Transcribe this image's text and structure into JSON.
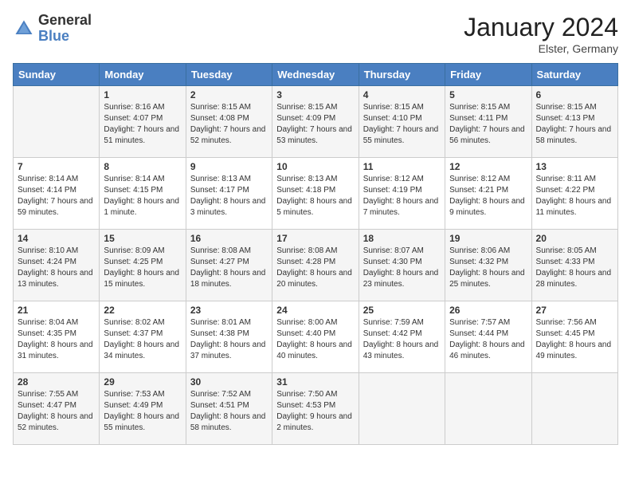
{
  "logo": {
    "general": "General",
    "blue": "Blue"
  },
  "title": "January 2024",
  "location": "Elster, Germany",
  "days_header": [
    "Sunday",
    "Monday",
    "Tuesday",
    "Wednesday",
    "Thursday",
    "Friday",
    "Saturday"
  ],
  "weeks": [
    [
      {
        "day": "",
        "sunrise": "",
        "sunset": "",
        "daylight": ""
      },
      {
        "day": "1",
        "sunrise": "Sunrise: 8:16 AM",
        "sunset": "Sunset: 4:07 PM",
        "daylight": "Daylight: 7 hours and 51 minutes."
      },
      {
        "day": "2",
        "sunrise": "Sunrise: 8:15 AM",
        "sunset": "Sunset: 4:08 PM",
        "daylight": "Daylight: 7 hours and 52 minutes."
      },
      {
        "day": "3",
        "sunrise": "Sunrise: 8:15 AM",
        "sunset": "Sunset: 4:09 PM",
        "daylight": "Daylight: 7 hours and 53 minutes."
      },
      {
        "day": "4",
        "sunrise": "Sunrise: 8:15 AM",
        "sunset": "Sunset: 4:10 PM",
        "daylight": "Daylight: 7 hours and 55 minutes."
      },
      {
        "day": "5",
        "sunrise": "Sunrise: 8:15 AM",
        "sunset": "Sunset: 4:11 PM",
        "daylight": "Daylight: 7 hours and 56 minutes."
      },
      {
        "day": "6",
        "sunrise": "Sunrise: 8:15 AM",
        "sunset": "Sunset: 4:13 PM",
        "daylight": "Daylight: 7 hours and 58 minutes."
      }
    ],
    [
      {
        "day": "7",
        "sunrise": "Sunrise: 8:14 AM",
        "sunset": "Sunset: 4:14 PM",
        "daylight": "Daylight: 7 hours and 59 minutes."
      },
      {
        "day": "8",
        "sunrise": "Sunrise: 8:14 AM",
        "sunset": "Sunset: 4:15 PM",
        "daylight": "Daylight: 8 hours and 1 minute."
      },
      {
        "day": "9",
        "sunrise": "Sunrise: 8:13 AM",
        "sunset": "Sunset: 4:17 PM",
        "daylight": "Daylight: 8 hours and 3 minutes."
      },
      {
        "day": "10",
        "sunrise": "Sunrise: 8:13 AM",
        "sunset": "Sunset: 4:18 PM",
        "daylight": "Daylight: 8 hours and 5 minutes."
      },
      {
        "day": "11",
        "sunrise": "Sunrise: 8:12 AM",
        "sunset": "Sunset: 4:19 PM",
        "daylight": "Daylight: 8 hours and 7 minutes."
      },
      {
        "day": "12",
        "sunrise": "Sunrise: 8:12 AM",
        "sunset": "Sunset: 4:21 PM",
        "daylight": "Daylight: 8 hours and 9 minutes."
      },
      {
        "day": "13",
        "sunrise": "Sunrise: 8:11 AM",
        "sunset": "Sunset: 4:22 PM",
        "daylight": "Daylight: 8 hours and 11 minutes."
      }
    ],
    [
      {
        "day": "14",
        "sunrise": "Sunrise: 8:10 AM",
        "sunset": "Sunset: 4:24 PM",
        "daylight": "Daylight: 8 hours and 13 minutes."
      },
      {
        "day": "15",
        "sunrise": "Sunrise: 8:09 AM",
        "sunset": "Sunset: 4:25 PM",
        "daylight": "Daylight: 8 hours and 15 minutes."
      },
      {
        "day": "16",
        "sunrise": "Sunrise: 8:08 AM",
        "sunset": "Sunset: 4:27 PM",
        "daylight": "Daylight: 8 hours and 18 minutes."
      },
      {
        "day": "17",
        "sunrise": "Sunrise: 8:08 AM",
        "sunset": "Sunset: 4:28 PM",
        "daylight": "Daylight: 8 hours and 20 minutes."
      },
      {
        "day": "18",
        "sunrise": "Sunrise: 8:07 AM",
        "sunset": "Sunset: 4:30 PM",
        "daylight": "Daylight: 8 hours and 23 minutes."
      },
      {
        "day": "19",
        "sunrise": "Sunrise: 8:06 AM",
        "sunset": "Sunset: 4:32 PM",
        "daylight": "Daylight: 8 hours and 25 minutes."
      },
      {
        "day": "20",
        "sunrise": "Sunrise: 8:05 AM",
        "sunset": "Sunset: 4:33 PM",
        "daylight": "Daylight: 8 hours and 28 minutes."
      }
    ],
    [
      {
        "day": "21",
        "sunrise": "Sunrise: 8:04 AM",
        "sunset": "Sunset: 4:35 PM",
        "daylight": "Daylight: 8 hours and 31 minutes."
      },
      {
        "day": "22",
        "sunrise": "Sunrise: 8:02 AM",
        "sunset": "Sunset: 4:37 PM",
        "daylight": "Daylight: 8 hours and 34 minutes."
      },
      {
        "day": "23",
        "sunrise": "Sunrise: 8:01 AM",
        "sunset": "Sunset: 4:38 PM",
        "daylight": "Daylight: 8 hours and 37 minutes."
      },
      {
        "day": "24",
        "sunrise": "Sunrise: 8:00 AM",
        "sunset": "Sunset: 4:40 PM",
        "daylight": "Daylight: 8 hours and 40 minutes."
      },
      {
        "day": "25",
        "sunrise": "Sunrise: 7:59 AM",
        "sunset": "Sunset: 4:42 PM",
        "daylight": "Daylight: 8 hours and 43 minutes."
      },
      {
        "day": "26",
        "sunrise": "Sunrise: 7:57 AM",
        "sunset": "Sunset: 4:44 PM",
        "daylight": "Daylight: 8 hours and 46 minutes."
      },
      {
        "day": "27",
        "sunrise": "Sunrise: 7:56 AM",
        "sunset": "Sunset: 4:45 PM",
        "daylight": "Daylight: 8 hours and 49 minutes."
      }
    ],
    [
      {
        "day": "28",
        "sunrise": "Sunrise: 7:55 AM",
        "sunset": "Sunset: 4:47 PM",
        "daylight": "Daylight: 8 hours and 52 minutes."
      },
      {
        "day": "29",
        "sunrise": "Sunrise: 7:53 AM",
        "sunset": "Sunset: 4:49 PM",
        "daylight": "Daylight: 8 hours and 55 minutes."
      },
      {
        "day": "30",
        "sunrise": "Sunrise: 7:52 AM",
        "sunset": "Sunset: 4:51 PM",
        "daylight": "Daylight: 8 hours and 58 minutes."
      },
      {
        "day": "31",
        "sunrise": "Sunrise: 7:50 AM",
        "sunset": "Sunset: 4:53 PM",
        "daylight": "Daylight: 9 hours and 2 minutes."
      },
      {
        "day": "",
        "sunrise": "",
        "sunset": "",
        "daylight": ""
      },
      {
        "day": "",
        "sunrise": "",
        "sunset": "",
        "daylight": ""
      },
      {
        "day": "",
        "sunrise": "",
        "sunset": "",
        "daylight": ""
      }
    ]
  ]
}
